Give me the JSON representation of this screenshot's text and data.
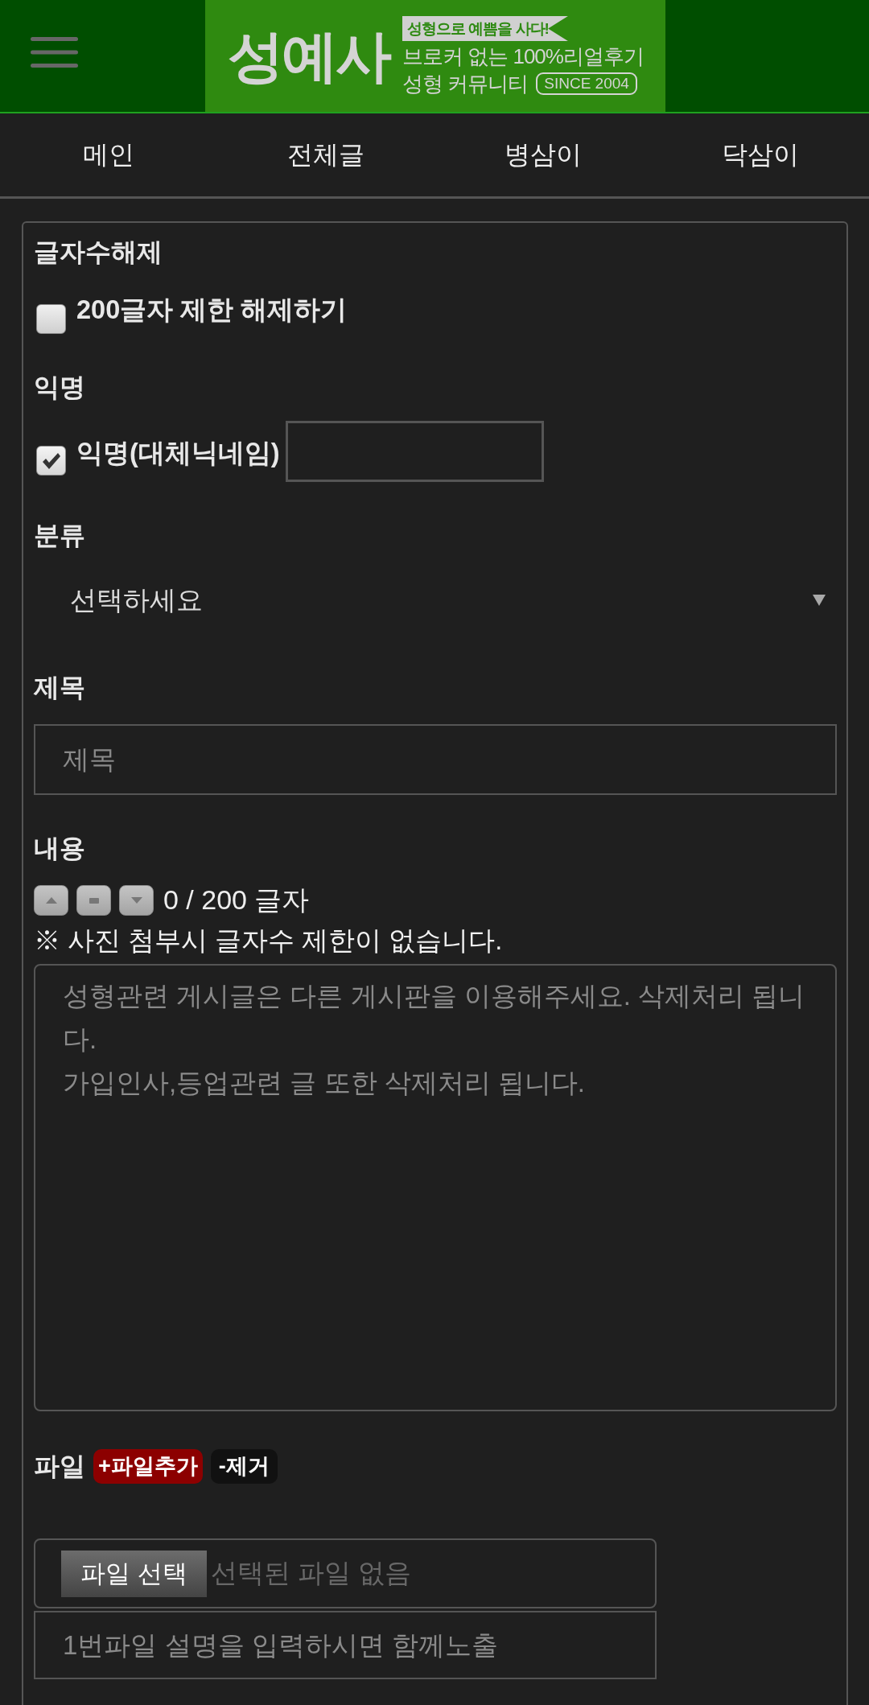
{
  "header": {
    "logo": {
      "name": "성예사",
      "slogan": "성형으로 예쁨을 사다!",
      "tagline": "브로커 없는 100%리얼후기",
      "subtitle": "성형 커뮤니티",
      "since": "SINCE 2004"
    }
  },
  "nav": [
    {
      "label": "메인"
    },
    {
      "label": "전체글"
    },
    {
      "label": "병삼이"
    },
    {
      "label": "닥삼이"
    }
  ],
  "form": {
    "sections": [
      {
        "kind": "checkbox",
        "label": "글자수해제",
        "option": "200글자 제한 해제하기",
        "checked": false
      },
      {
        "kind": "checkbox",
        "label": "익명",
        "option": "익명(대체닉네임)",
        "checked": true,
        "with_input": true
      },
      {
        "kind": "select",
        "label": "분류",
        "value": "선택하세요"
      },
      {
        "kind": "text",
        "label": "제목",
        "placeholder": "제목"
      },
      {
        "kind": "textarea",
        "label": "내용",
        "counter": "0 / 200 글자",
        "note": "※ 사진 첨부시 글자수 제한이 없습니다.",
        "placeholder": "성형관련 게시글은 다른 게시판을 이용해주세요. 삭제처리 됩니다.\n가입인사,등업관련 글 또한 삭제처리 됩니다."
      },
      {
        "kind": "file",
        "label": "파일",
        "add_button": "+파일추가",
        "remove_button": "-제거",
        "choose_button": "파일 선택",
        "status": "선택된 파일 없음",
        "description_placeholder": "1번파일 설명을 입력하시면 함께노출"
      }
    ]
  }
}
